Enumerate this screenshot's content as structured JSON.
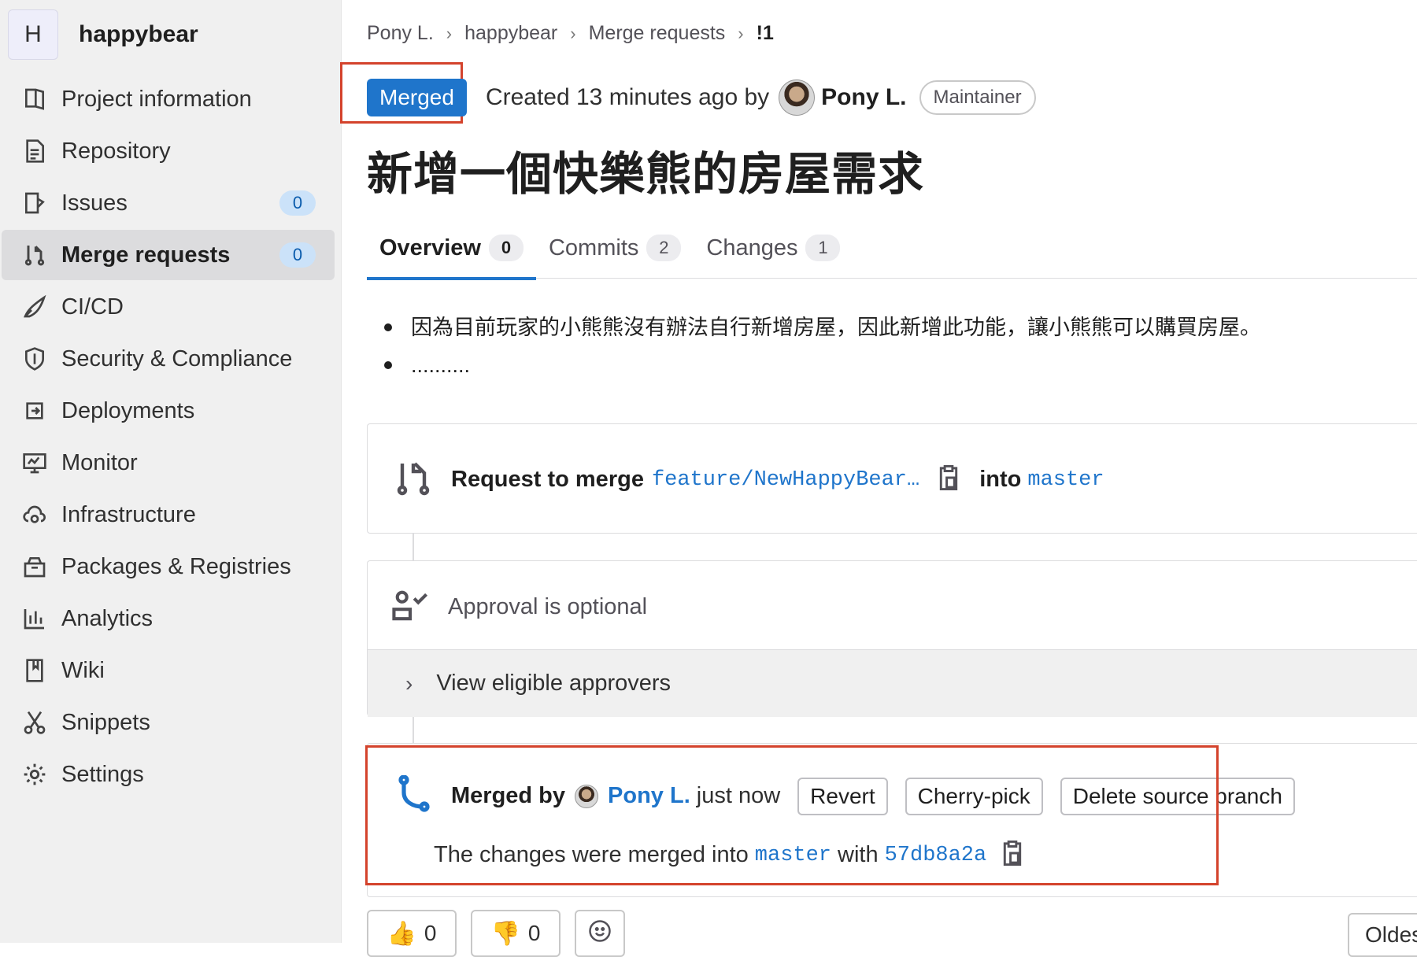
{
  "project": {
    "avatar_letter": "H",
    "name": "happybear"
  },
  "sidebar": {
    "items": [
      {
        "label": "Project information",
        "icon": "project-info-icon"
      },
      {
        "label": "Repository",
        "icon": "repository-icon"
      },
      {
        "label": "Issues",
        "icon": "issues-icon",
        "badge": "0"
      },
      {
        "label": "Merge requests",
        "icon": "merge-request-icon",
        "badge": "0",
        "active": true
      },
      {
        "label": "CI/CD",
        "icon": "rocket-icon"
      },
      {
        "label": "Security & Compliance",
        "icon": "shield-icon"
      },
      {
        "label": "Deployments",
        "icon": "deployments-icon"
      },
      {
        "label": "Monitor",
        "icon": "monitor-icon"
      },
      {
        "label": "Infrastructure",
        "icon": "cloud-gear-icon"
      },
      {
        "label": "Packages & Registries",
        "icon": "package-icon"
      },
      {
        "label": "Analytics",
        "icon": "chart-icon"
      },
      {
        "label": "Wiki",
        "icon": "book-icon"
      },
      {
        "label": "Snippets",
        "icon": "scissors-icon"
      },
      {
        "label": "Settings",
        "icon": "gear-icon"
      }
    ]
  },
  "breadcrumb": {
    "items": [
      "Pony L.",
      "happybear",
      "Merge requests",
      "!1"
    ]
  },
  "mr": {
    "status": "Merged",
    "created_text": "Created 13 minutes ago by",
    "author": "Pony L.",
    "role": "Maintainer",
    "title": "新增一個快樂熊的房屋需求"
  },
  "tabs": [
    {
      "label": "Overview",
      "count": "0",
      "active": true
    },
    {
      "label": "Commits",
      "count": "2"
    },
    {
      "label": "Changes",
      "count": "1"
    }
  ],
  "description": [
    "因為目前玩家的小熊熊沒有辦法自行新增房屋，因此新增此功能，讓小熊熊可以購買房屋。",
    ".........."
  ],
  "merge_request_widget": {
    "request_label": "Request to merge",
    "source_branch": "feature/NewHappyBear…",
    "into_label": "into",
    "target_branch": "master"
  },
  "approval": {
    "text": "Approval is optional",
    "view_approvers": "View eligible approvers"
  },
  "merged": {
    "merged_by_label": "Merged by",
    "user": "Pony L.",
    "time": "just now",
    "buttons": {
      "revert": "Revert",
      "cherry_pick": "Cherry-pick",
      "delete_branch": "Delete source branch"
    },
    "changes_text": "The changes were merged into",
    "branch": "master",
    "with_label": "with",
    "commit": "57db8a2a"
  },
  "reactions": {
    "thumbs_up": "0",
    "thumbs_down": "0"
  },
  "sort": {
    "label": "Oldest first"
  },
  "colors": {
    "accent": "#1f75cb",
    "highlight": "#d4432c",
    "sidebar_bg": "#f0f0f0"
  }
}
